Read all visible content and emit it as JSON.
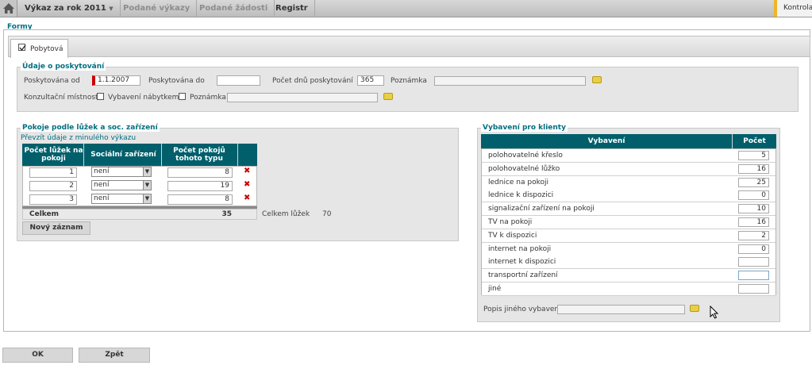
{
  "nav": {
    "tabs": [
      "Výkaz za rok 2011",
      "Podané výkazy",
      "Podané žádosti",
      "Registr"
    ],
    "right_label": "Kontrola"
  },
  "formy_title": "Formy",
  "form_tab": "Pobytová",
  "provision": {
    "title": "Údaje o poskytování",
    "from_label": "Poskytována od",
    "from_value": "1.1.2007",
    "to_label": "Poskytována do",
    "to_value": "",
    "days_label": "Počet dnů poskytování",
    "days_value": "365",
    "note_label": "Poznámka",
    "note_value": "",
    "room_label": "Konzultační místnost",
    "furniture_label": "Vybavení nábytkem",
    "note2_label": "Poznámka",
    "note2_value": ""
  },
  "rooms": {
    "title": "Pokoje podle lůžek a soc. zařízení",
    "copy_link": "Převzít údaje z minulého výkazu",
    "headers": [
      "Počet lůžek na pokoji",
      "Sociální zařízení",
      "Počet pokojů tohoto typu"
    ],
    "rows": [
      {
        "beds": "1",
        "social": "není",
        "count": "8"
      },
      {
        "beds": "2",
        "social": "není",
        "count": "19"
      },
      {
        "beds": "3",
        "social": "není",
        "count": "8"
      }
    ],
    "total_label": "Celkem",
    "total_value": "35",
    "beds_total_label": "Celkem lůžek",
    "beds_total_value": "70",
    "new_button": "Nový záznam"
  },
  "equipment": {
    "title": "Vybavení pro klienty",
    "headers": [
      "Vybavení",
      "Počet"
    ],
    "rows": [
      {
        "name": "polohovatelné křeslo",
        "count": "5"
      },
      {
        "name": "polohovatelné lůžko",
        "count": "16"
      },
      {
        "name": "lednice na pokoji",
        "count": "25"
      },
      {
        "name": "lednice k dispozici",
        "count": "0"
      },
      {
        "name": "signalizační zařízení na pokoji",
        "count": "10"
      },
      {
        "name": "TV na pokoji",
        "count": "16"
      },
      {
        "name": "TV k dispozici",
        "count": "2"
      },
      {
        "name": "internet na pokoji",
        "count": "0"
      },
      {
        "name": "internet k dispozici",
        "count": ""
      },
      {
        "name": "transportní zařízení",
        "count": ""
      },
      {
        "name": "jiné",
        "count": ""
      }
    ],
    "other_label": "Popis jiného vybavení",
    "other_value": ""
  },
  "buttons": {
    "ok": "OK",
    "back": "Zpět"
  },
  "colors": {
    "teal": "#005f6b",
    "accent": "#f0b429",
    "error": "#cc0000"
  }
}
